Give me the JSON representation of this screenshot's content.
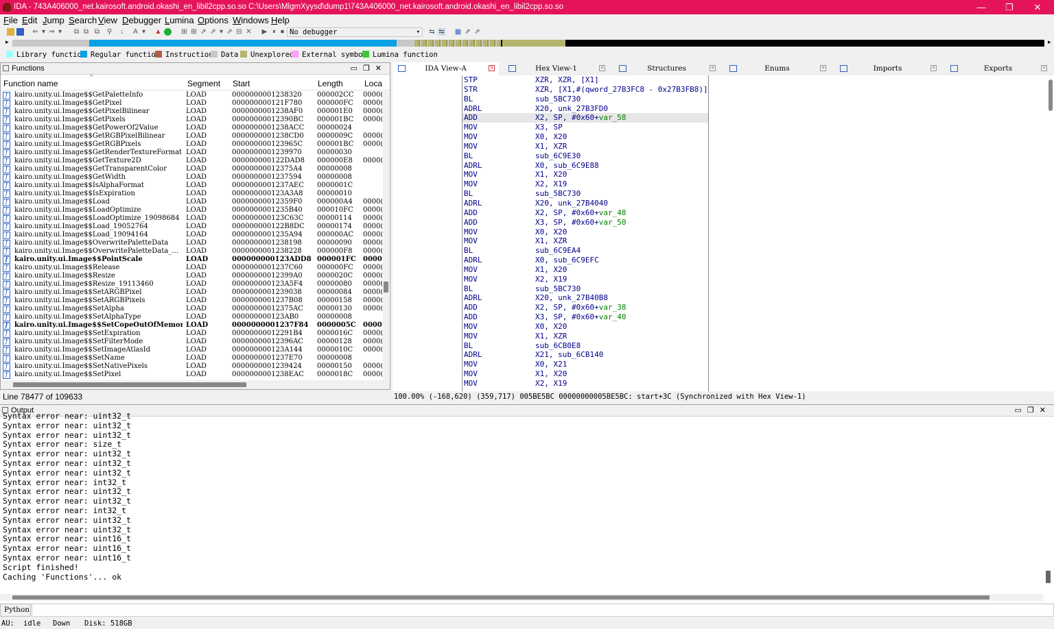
{
  "window": {
    "title": "IDA - 743A406000_net.kairosoft.android.okashi_en_libil2cpp.so.so C:\\Users\\MlgmXyysd\\dump1\\743A406000_net.kairosoft.android.okashi_en_libil2cpp.so.so",
    "minimize": "—",
    "maximize": "❐",
    "close": "✕"
  },
  "menu": [
    "File",
    "Edit",
    "Jump",
    "Search",
    "View",
    "Debugger",
    "Lumina",
    "Options",
    "Windows",
    "Help"
  ],
  "toolbar": {
    "debugger_select": "No debugger"
  },
  "legend": [
    {
      "label": "Library function",
      "color": "#9dfffd"
    },
    {
      "label": "Regular function",
      "color": "#0aa0e6"
    },
    {
      "label": "Instruction",
      "color": "#b56045"
    },
    {
      "label": "Data",
      "color": "#c8c8c8"
    },
    {
      "label": "Unexplored",
      "color": "#b5b56e"
    },
    {
      "label": "External symbol",
      "color": "#ff9eff"
    },
    {
      "label": "Lumina function",
      "color": "#3cc83c"
    }
  ],
  "functions_panel": {
    "title": "Functions",
    "columns": [
      "Function name",
      "Segment",
      "Start",
      "Length",
      "Loca"
    ],
    "rows": [
      {
        "name": "kairo.unity.ui.Image$$GetPaletteInfo",
        "seg": "LOAD",
        "start": "0000000001238320",
        "len": "000002CC",
        "loc": "0000("
      },
      {
        "name": "kairo.unity.ui.Image$$GetPixel",
        "seg": "LOAD",
        "start": "000000000121F780",
        "len": "000000FC",
        "loc": "0000("
      },
      {
        "name": "kairo.unity.ui.Image$$GetPixelBilinear",
        "seg": "LOAD",
        "start": "0000000001238AF0",
        "len": "000001E0",
        "loc": "0000("
      },
      {
        "name": "kairo.unity.ui.Image$$GetPixels",
        "seg": "LOAD",
        "start": "00000000012390BC",
        "len": "000001BC",
        "loc": "0000("
      },
      {
        "name": "kairo.unity.ui.Image$$GetPowerOf2Value",
        "seg": "LOAD",
        "start": "0000000001238ACC",
        "len": "00000024",
        "loc": ""
      },
      {
        "name": "kairo.unity.ui.Image$$GetRGBPixelBilinear",
        "seg": "LOAD",
        "start": "0000000001238CD0",
        "len": "0000009C",
        "loc": "0000("
      },
      {
        "name": "kairo.unity.ui.Image$$GetRGBPixels",
        "seg": "LOAD",
        "start": "000000000123965C",
        "len": "000001BC",
        "loc": "0000("
      },
      {
        "name": "kairo.unity.ui.Image$$GetRenderTextureFormat",
        "seg": "LOAD",
        "start": "0000000001239970",
        "len": "00000030",
        "loc": ""
      },
      {
        "name": "kairo.unity.ui.Image$$GetTexture2D",
        "seg": "LOAD",
        "start": "000000000122DAD8",
        "len": "000000E8",
        "loc": "0000("
      },
      {
        "name": "kairo.unity.ui.Image$$GetTransparentColor",
        "seg": "LOAD",
        "start": "00000000012375A4",
        "len": "00000008",
        "loc": ""
      },
      {
        "name": "kairo.unity.ui.Image$$GetWidth",
        "seg": "LOAD",
        "start": "0000000001237594",
        "len": "00000008",
        "loc": ""
      },
      {
        "name": "kairo.unity.ui.Image$$IsAlphaFormat",
        "seg": "LOAD",
        "start": "0000000001237AEC",
        "len": "0000001C",
        "loc": ""
      },
      {
        "name": "kairo.unity.ui.Image$$IsExpiration",
        "seg": "LOAD",
        "start": "000000000123A3A8",
        "len": "00000010",
        "loc": ""
      },
      {
        "name": "kairo.unity.ui.Image$$Load",
        "seg": "LOAD",
        "start": "00000000012359F0",
        "len": "000000A4",
        "loc": "0000("
      },
      {
        "name": "kairo.unity.ui.Image$$LoadOptimize",
        "seg": "LOAD",
        "start": "0000000001235B40",
        "len": "000010FC",
        "loc": "0000("
      },
      {
        "name": "kairo.unity.ui.Image$$LoadOptimize_19098684",
        "seg": "LOAD",
        "start": "000000000123C63C",
        "len": "00000114",
        "loc": "0000("
      },
      {
        "name": "kairo.unity.ui.Image$$Load_19052764",
        "seg": "LOAD",
        "start": "000000000122B8DC",
        "len": "00000174",
        "loc": "0000("
      },
      {
        "name": "kairo.unity.ui.Image$$Load_19094164",
        "seg": "LOAD",
        "start": "0000000001235A94",
        "len": "000000AC",
        "loc": "0000("
      },
      {
        "name": "kairo.unity.ui.Image$$OverwritePaletteData",
        "seg": "LOAD",
        "start": "0000000001238198",
        "len": "00000090",
        "loc": "0000("
      },
      {
        "name": "kairo.unity.ui.Image$$OverwritePaletteData_…",
        "seg": "LOAD",
        "start": "0000000001238228",
        "len": "000000F8",
        "loc": "0000("
      },
      {
        "name": "kairo.unity.ui.Image$$PointScale",
        "seg": "LOAD",
        "start": "000000000123ADD8",
        "len": "000001FC",
        "loc": "0000",
        "bold": true
      },
      {
        "name": "kairo.unity.ui.Image$$Release",
        "seg": "LOAD",
        "start": "0000000001237C60",
        "len": "000000FC",
        "loc": "0000("
      },
      {
        "name": "kairo.unity.ui.Image$$Resize",
        "seg": "LOAD",
        "start": "00000000012399A0",
        "len": "0000020C",
        "loc": "0000("
      },
      {
        "name": "kairo.unity.ui.Image$$Resize_19113460",
        "seg": "LOAD",
        "start": "000000000123A5F4",
        "len": "00000080",
        "loc": "0000("
      },
      {
        "name": "kairo.unity.ui.Image$$SetARGBPixel",
        "seg": "LOAD",
        "start": "0000000001239038",
        "len": "00000084",
        "loc": "0000("
      },
      {
        "name": "kairo.unity.ui.Image$$SetARGBPixels",
        "seg": "LOAD",
        "start": "0000000001237B08",
        "len": "00000158",
        "loc": "0000("
      },
      {
        "name": "kairo.unity.ui.Image$$SetAlpha",
        "seg": "LOAD",
        "start": "00000000012375AC",
        "len": "00000130",
        "loc": "0000("
      },
      {
        "name": "kairo.unity.ui.Image$$SetAlphaType",
        "seg": "LOAD",
        "start": "000000000123AB0",
        "len": "00000008",
        "loc": ""
      },
      {
        "name": "kairo.unity.ui.Image$$SetCopeOutOfMemor…",
        "seg": "LOAD",
        "start": "0000000001237F84",
        "len": "0000005C",
        "loc": "0000",
        "bold": true
      },
      {
        "name": "kairo.unity.ui.Image$$SetExpiration",
        "seg": "LOAD",
        "start": "00000000012291B4",
        "len": "0000016C",
        "loc": "0000("
      },
      {
        "name": "kairo.unity.ui.Image$$SetFilterMode",
        "seg": "LOAD",
        "start": "00000000012396AC",
        "len": "00000128",
        "loc": "0000("
      },
      {
        "name": "kairo.unity.ui.Image$$SetImageAtlasId",
        "seg": "LOAD",
        "start": "000000000123A144",
        "len": "0000010C",
        "loc": "0000("
      },
      {
        "name": "kairo.unity.ui.Image$$SetName",
        "seg": "LOAD",
        "start": "0000000001237E70",
        "len": "00000008",
        "loc": ""
      },
      {
        "name": "kairo.unity.ui.Image$$SetNativePixels",
        "seg": "LOAD",
        "start": "0000000001239424",
        "len": "00000150",
        "loc": "0000("
      },
      {
        "name": "kairo.unity.ui.Image$$SetPixel",
        "seg": "LOAD",
        "start": "0000000001238EAC",
        "len": "0000018C",
        "loc": "0000("
      }
    ],
    "line_info": "Line 78477 of 109633"
  },
  "tabs": [
    {
      "label": "IDA View-A",
      "active": true
    },
    {
      "label": "Hex View-1"
    },
    {
      "label": "Structures"
    },
    {
      "label": "Enums"
    },
    {
      "label": "Imports"
    },
    {
      "label": "Exports"
    }
  ],
  "disasm": [
    {
      "m": "STP",
      "o": "XZR, XZR, [X1]"
    },
    {
      "m": "STR",
      "o": "XZR, [X1,#(qword_27B3FC8 - 0x27B3FB8)]"
    },
    {
      "m": "BL",
      "o": "sub_5BC730"
    },
    {
      "m": "ADRL",
      "o": "X20, unk_27B3FD0"
    },
    {
      "m": "ADD",
      "o": "X2, SP, #0x60+",
      "v": "var_58",
      "hl": true
    },
    {
      "m": "MOV",
      "o": "X3, SP"
    },
    {
      "m": "MOV",
      "o": "X0, X20"
    },
    {
      "m": "MOV",
      "o": "X1, XZR"
    },
    {
      "m": "BL",
      "o": "sub_6C9E30"
    },
    {
      "m": "ADRL",
      "o": "X0, sub_6C9E88"
    },
    {
      "m": "MOV",
      "o": "X1, X20"
    },
    {
      "m": "MOV",
      "o": "X2, X19"
    },
    {
      "m": "BL",
      "o": "sub_5BC730"
    },
    {
      "m": "ADRL",
      "o": "X20, unk_27B4040"
    },
    {
      "m": "ADD",
      "o": "X2, SP, #0x60+",
      "v": "var_48"
    },
    {
      "m": "ADD",
      "o": "X3, SP, #0x60+",
      "v": "var_50"
    },
    {
      "m": "MOV",
      "o": "X0, X20"
    },
    {
      "m": "MOV",
      "o": "X1, XZR"
    },
    {
      "m": "BL",
      "o": "sub_6C9EA4"
    },
    {
      "m": "ADRL",
      "o": "X0, sub_6C9EFC"
    },
    {
      "m": "MOV",
      "o": "X1, X20"
    },
    {
      "m": "MOV",
      "o": "X2, X19"
    },
    {
      "m": "BL",
      "o": "sub_5BC730"
    },
    {
      "m": "ADRL",
      "o": "X20, unk_27B40B8"
    },
    {
      "m": "ADD",
      "o": "X2, SP, #0x60+",
      "v": "var_38"
    },
    {
      "m": "ADD",
      "o": "X3, SP, #0x60+",
      "v": "var_40"
    },
    {
      "m": "MOV",
      "o": "X0, X20"
    },
    {
      "m": "MOV",
      "o": "X1, XZR"
    },
    {
      "m": "BL",
      "o": "sub_6CB0E8"
    },
    {
      "m": "ADRL",
      "o": "X21, sub_6CB140"
    },
    {
      "m": "MOV",
      "o": "X0, X21"
    },
    {
      "m": "MOV",
      "o": "X1, X20"
    },
    {
      "m": "MOV",
      "o": "X2, X19"
    }
  ],
  "ida_status": "100.00% (-168,620) (359,717) 005BE5BC 00000000005BE5BC: start+3C (Synchronized with Hex View-1)",
  "output": {
    "title": "Output",
    "lines": [
      "Syntax error near: uint32_t",
      "Syntax error near: uint32_t",
      "Syntax error near: uint32_t",
      "Syntax error near: size_t",
      "Syntax error near: uint32_t",
      "Syntax error near: uint32_t",
      "Syntax error near: uint32_t",
      "Syntax error near: int32_t",
      "Syntax error near: uint32_t",
      "Syntax error near: uint32_t",
      "Syntax error near: int32_t",
      "Syntax error near: uint32_t",
      "Syntax error near: uint32_t",
      "Syntax error near: uint16_t",
      "Syntax error near: uint16_t",
      "Syntax error near: uint16_t",
      "Script finished!",
      "Caching 'Functions'... ok"
    ]
  },
  "python": {
    "lang": "Python"
  },
  "statusbar": {
    "au": "AU:",
    "state": "idle",
    "dir": "Down",
    "disk": "Disk: 518GB"
  }
}
